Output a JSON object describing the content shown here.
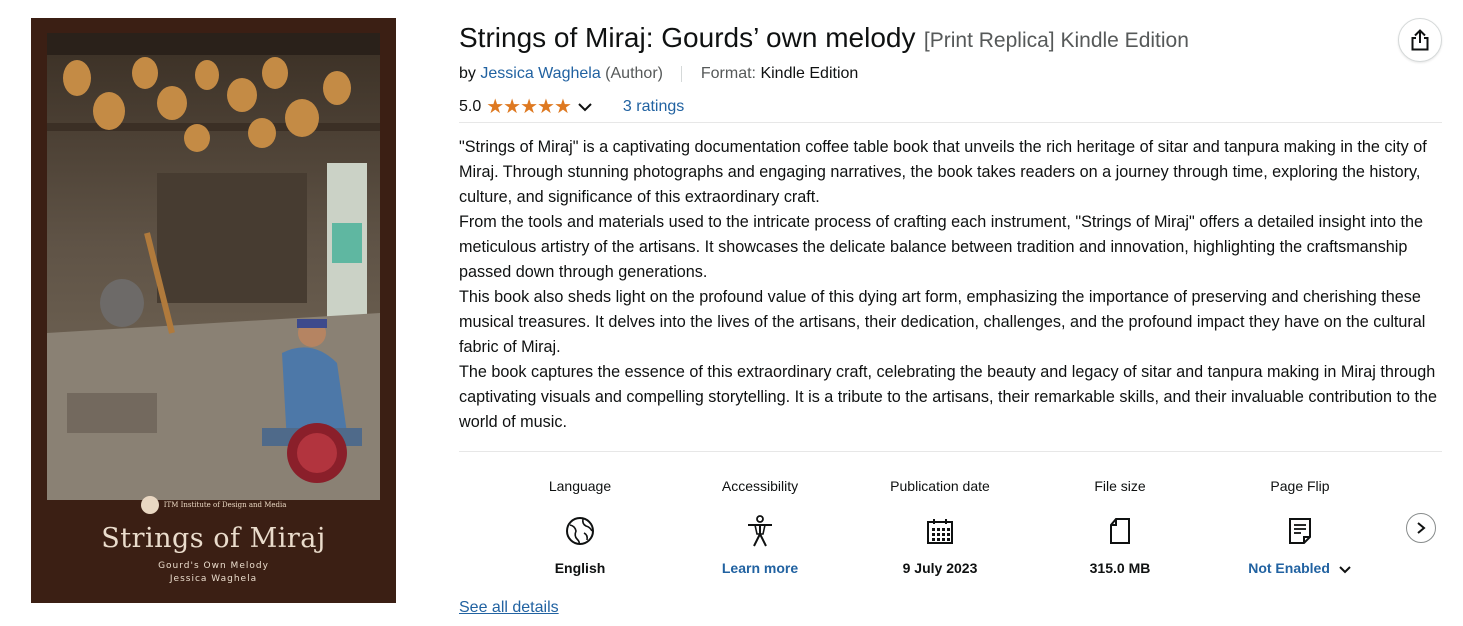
{
  "product": {
    "title": "Strings of Miraj: Gourds’ own melody",
    "edition": "[Print Replica] Kindle Edition",
    "byline_prefix": "by",
    "author": "Jessica Waghela",
    "author_role": "(Author)",
    "format_label": "Format:",
    "format_value": "Kindle Edition",
    "rating_value": "5.0",
    "ratings_count": "3 ratings",
    "stars_icon": "five-star-rating-icon"
  },
  "cover": {
    "logo_text": "ITM Institute of Design and Media",
    "title": "Strings of Miraj",
    "subtitle": "Gourd's Own Melody",
    "author": "Jessica Waghela"
  },
  "description": [
    "\"Strings of Miraj\" is a captivating documentation coffee table book that unveils the rich heritage of sitar and tanpura making in the city of Miraj. Through stunning photographs and engaging narratives, the book takes readers on a journey through time, exploring the history, culture, and significance of this extraordinary craft.",
    "From the tools and materials used to the intricate process of crafting each instrument, \"Strings of Miraj\" offers a detailed insight into the meticulous artistry of the artisans. It showcases the delicate balance between tradition and innovation, highlighting the craftsmanship passed down through generations.",
    "This book also sheds light on the profound value of this dying art form, emphasizing the importance of preserving and cherishing these musical treasures. It delves into the lives of the artisans, their dedication, challenges, and the profound impact they have on the cultural fabric of Miraj.",
    "The book captures the essence of this extraordinary craft, celebrating the beauty and legacy of sitar and tanpura making in Miraj through captivating visuals and compelling storytelling. It is a tribute to the artisans, their remarkable skills, and their invaluable contribution to the world of music."
  ],
  "details": [
    {
      "label": "Language",
      "value": "English",
      "icon": "globe-icon"
    },
    {
      "label": "Accessibility",
      "value": "Learn more",
      "icon": "accessibility-person-icon"
    },
    {
      "label": "Publication date",
      "value": "9 July 2023",
      "icon": "calendar-icon"
    },
    {
      "label": "File size",
      "value": "315.0 MB",
      "icon": "file-icon"
    },
    {
      "label": "Page Flip",
      "value": "Not Enabled",
      "icon": "page-flip-icon"
    }
  ],
  "see_all_details": "See all details",
  "colors": {
    "link": "#2162a1",
    "star": "#de7921",
    "cover_bg": "#3b1f14"
  }
}
